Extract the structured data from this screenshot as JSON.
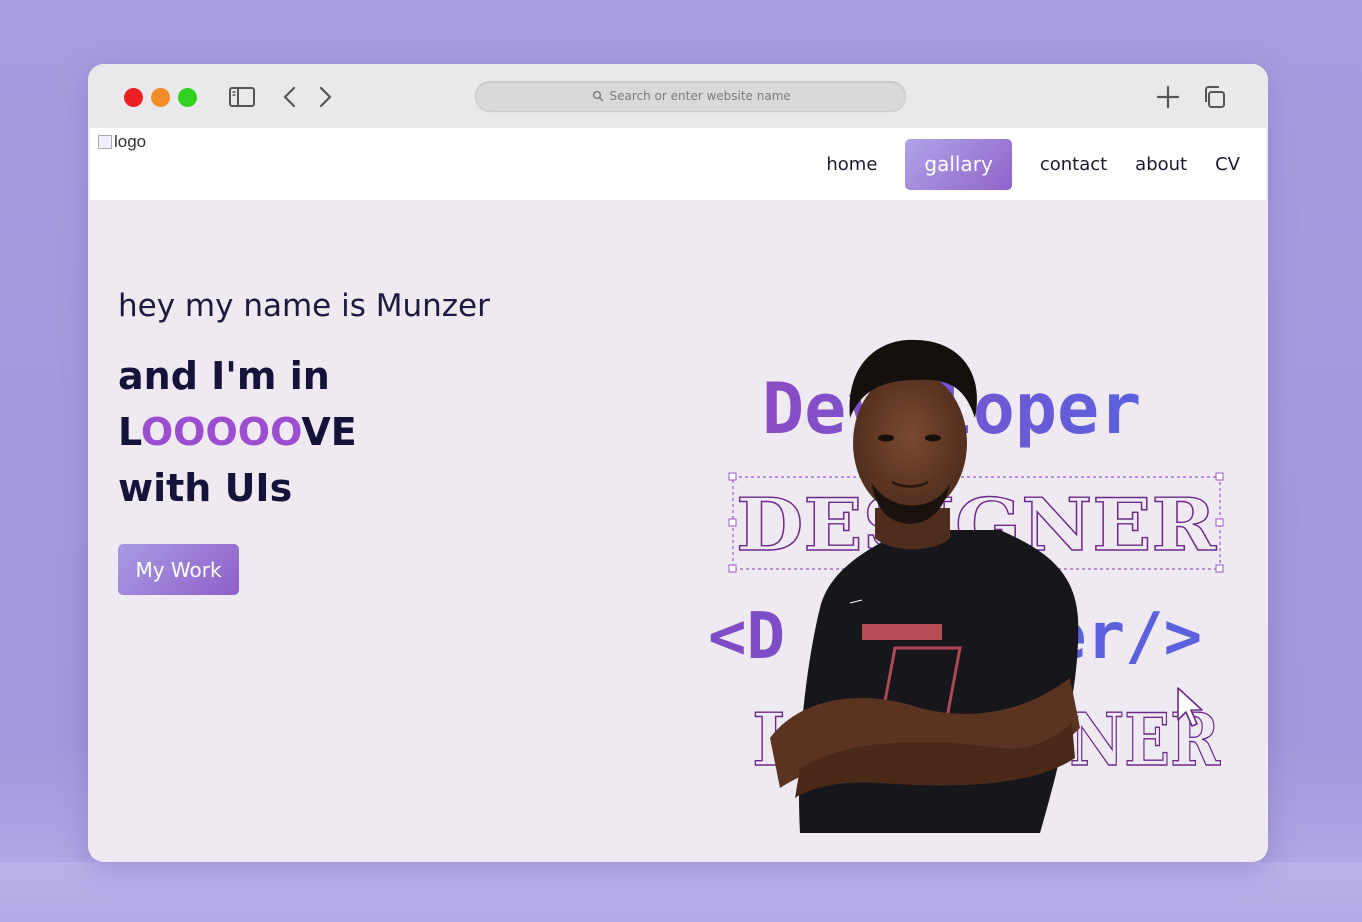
{
  "browser": {
    "search_placeholder": "Search or enter website name",
    "icons": [
      "sidebar-icon",
      "back-icon",
      "forward-icon",
      "search-icon",
      "new-tab-icon",
      "tabs-icon"
    ]
  },
  "navbar": {
    "logo_alt": "logo",
    "links": [
      {
        "label": "home",
        "active": false
      },
      {
        "label": "gallary",
        "active": true
      },
      {
        "label": "contact",
        "active": false
      },
      {
        "label": "about",
        "active": false
      },
      {
        "label": "CV",
        "active": false
      }
    ]
  },
  "hero": {
    "intro": "hey my name is Munzer",
    "line1": "and I'm in",
    "line2_start": "L",
    "line2_highlight": "OOOOO",
    "line2_end": "VE",
    "line3": "with UIs",
    "cta_label": "My Work"
  },
  "art": {
    "word1": "Developer",
    "word2": "DESIGNER",
    "word3_pre": "<D",
    "word3_post": "er/>",
    "word4": "IGNER"
  },
  "colors": {
    "accent": "#9b4fd0",
    "button_start": "#a99be4",
    "button_end": "#8e5fc7",
    "heading": "#15133a",
    "background": "#efeaf1",
    "outer": "#a99de0"
  }
}
